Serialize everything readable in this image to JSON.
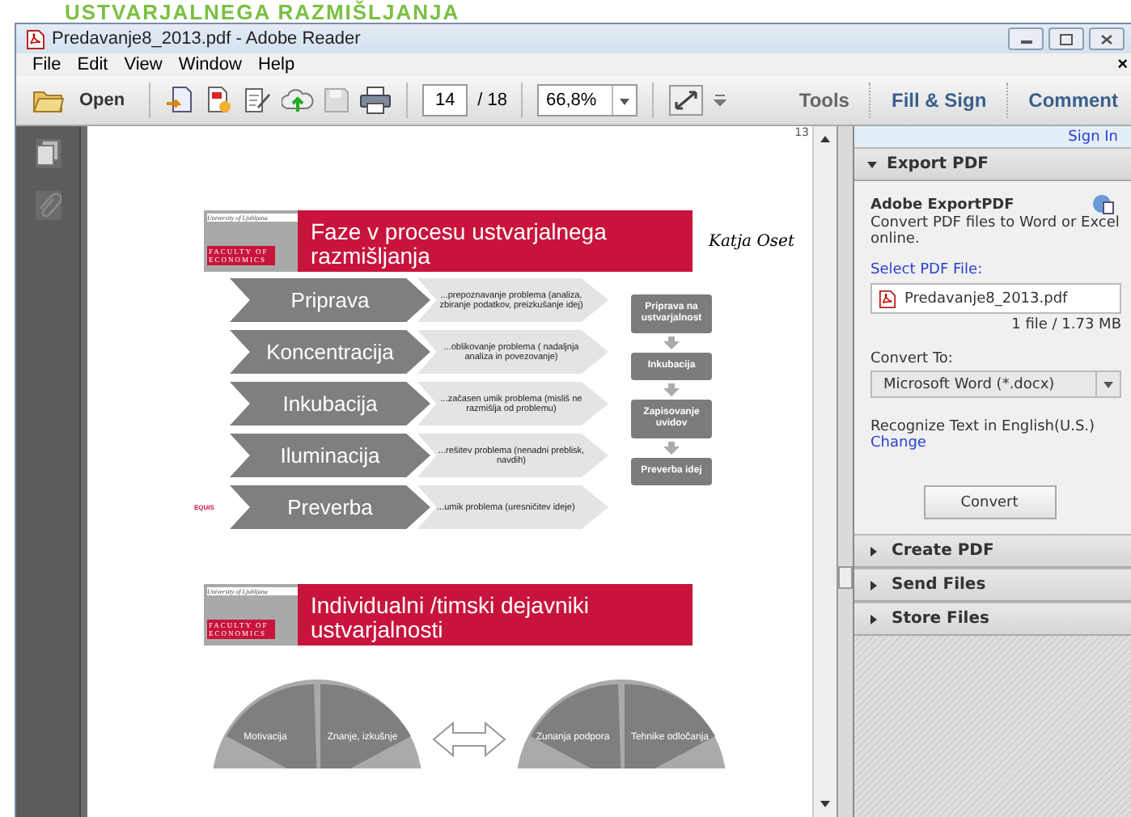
{
  "banner": {
    "text": "USTVARJALNEGA RAZMIŠLJANJA"
  },
  "window": {
    "title": "Predavanje8_2013.pdf - Adobe Reader"
  },
  "menu": [
    "File",
    "Edit",
    "View",
    "Window",
    "Help"
  ],
  "menu_close": "×",
  "toolbar": {
    "open": "Open",
    "page": "14",
    "page_total": "/ 18",
    "zoom": "66,8%",
    "links": [
      "Tools",
      "Fill & Sign",
      "Comment"
    ]
  },
  "document": {
    "page_marker": "13",
    "slide1": {
      "logo": {
        "university": "University of Ljubljana",
        "faculty": "FACULTY OF",
        "school": "ECONOMICS",
        "accreditation": "EQUIS"
      },
      "title": "Faze v procesu ustvarjalnega razmišljanja",
      "author": "Katja Oset",
      "phases": [
        {
          "name": "Priprava",
          "desc": "...prepoznavanje problema (analiza, zbiranje podatkov, preizkušanje idej)"
        },
        {
          "name": "Koncentracija",
          "desc": "...oblikovanje problema ( nadaljnja analiza in povezovanje)"
        },
        {
          "name": "Inkubacija",
          "desc": "...začasen umik problema (misliš ne razmišlja od problemu)"
        },
        {
          "name": "Iluminacija",
          "desc": "...rešitev problema (nenadni preblisk, navdih)"
        },
        {
          "name": "Preverba",
          "desc": "...umik problema (uresničitev ideje)"
        }
      ],
      "flow": [
        "Priprava na ustvarjalnost",
        "Inkubacija",
        "Zapisovanje uvidov",
        "Preverba idej"
      ]
    },
    "slide2": {
      "logo": {
        "university": "University of Ljubljana",
        "faculty": "FACULTY OF",
        "school": "ECONOMICS"
      },
      "title": "Individualni /timski dejavniki ustvarjalnosti",
      "left_cycle": [
        "Motivacija",
        "Znanje, izkušnje"
      ],
      "right_cycle": [
        "Zunanja podpora",
        "Tehnike odločanja"
      ]
    }
  },
  "panel": {
    "sign_in": "Sign In",
    "sections": [
      {
        "title": "Export PDF",
        "expanded": true
      },
      {
        "title": "Create PDF",
        "expanded": false
      },
      {
        "title": "Send Files",
        "expanded": false
      },
      {
        "title": "Store Files",
        "expanded": false
      }
    ],
    "export": {
      "heading": "Adobe ExportPDF",
      "description": "Convert PDF files to Word or Excel online.",
      "select_label": "Select PDF File:",
      "file": "Predavanje8_2013.pdf",
      "file_info": "1 file / 1.73 MB",
      "convert_label": "Convert To:",
      "format": "Microsoft Word (*.docx)",
      "recognize": "Recognize Text in English(U.S.)",
      "change": "Change",
      "button": "Convert"
    }
  }
}
